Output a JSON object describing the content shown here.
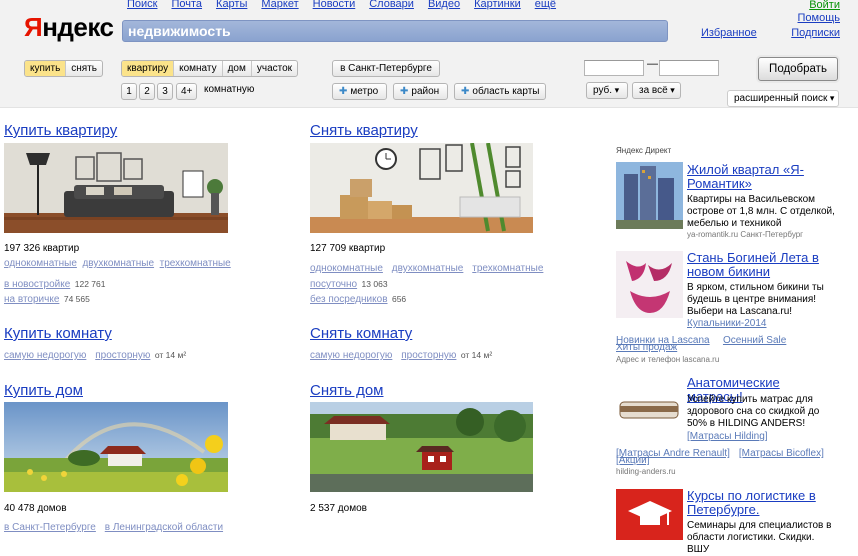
{
  "header": {
    "logo_a": "Я",
    "logo_b": "ндекс",
    "nav": [
      "Поиск",
      "Почта",
      "Карты",
      "Маркет",
      "Новости",
      "Словари",
      "Видео",
      "Картинки",
      "ещё"
    ],
    "login": "Войти",
    "help": "Помощь",
    "subscriptions": "Подписки",
    "favorites": "Избранное",
    "search_value": "недвижимость"
  },
  "filters": {
    "deal": [
      "купить",
      "снять"
    ],
    "deal_selected": "купить",
    "type": [
      "квартиру",
      "комнату",
      "дом",
      "участок"
    ],
    "type_selected": "квартиру",
    "rooms": [
      "1",
      "2",
      "3",
      "4+"
    ],
    "rooms_label": "комнатную",
    "city": "в Санкт-Петербурге",
    "metro": "метро",
    "district": "район",
    "map_area": "область карты",
    "dash": "—",
    "currency": "руб.",
    "price_period": "за всё",
    "submit": "Подобрать",
    "advanced": "расширенный поиск"
  },
  "sections": {
    "buy_flat": {
      "title": "Купить квартиру",
      "count": "197 326 квартир",
      "links": [
        "однокомнатные",
        "двухкомнатные",
        "трехкомнатные"
      ],
      "new": "в новостройке",
      "new_count": "122 761",
      "secondary": "на вторичке",
      "secondary_count": "74 565"
    },
    "rent_flat": {
      "title": "Снять квартиру",
      "count": "127 709 квартир",
      "links": [
        "однокомнатные",
        "двухкомнатные",
        "трехкомнатные"
      ],
      "daily": "посуточно",
      "daily_count": "13 063",
      "no_agent": "без посредников",
      "no_agent_count": "656"
    },
    "buy_room": {
      "title": "Купить комнату",
      "cheap": "самую недорогую",
      "spacious": "просторную",
      "from": "от 14 м²"
    },
    "rent_room": {
      "title": "Снять комнату",
      "cheap": "самую недорогую",
      "spacious": "просторную",
      "from": "от 14 м²"
    },
    "buy_house": {
      "title": "Купить дом",
      "count": "40 478 домов",
      "spb": "в Санкт-Петербурге",
      "lo": "в Ленинградской области"
    },
    "rent_house": {
      "title": "Снять дом",
      "count": "2 537 домов"
    }
  },
  "direct": {
    "header": "Яндекс Директ",
    "ads": [
      {
        "title": "Жилой квартал «Я-Романтик»",
        "text": "Квартиры на Васильевском острове от 1,8 млн. С отделкой, мебелью и техникой",
        "meta": "ya-romantik.ru   Санкт-Петербург"
      },
      {
        "title": "Стань Богиней Лета в новом бикини",
        "text": "В ярком, стильном бикини ты будешь в центре внимания! Выбери на Lascana.ru!",
        "links": [
          "Купальники-2014",
          "Новинки на Lascana",
          "Осенний Sale",
          "Хиты продаж"
        ],
        "meta": "Адрес и телефон   lascana.ru"
      },
      {
        "title": "Анатомические матрасы!",
        "text": "Успейте купить матрас для здорового сна со скидкой до 50% в HILDING ANDERS!",
        "links": [
          "[Матрасы Hilding]",
          "[Матрасы Andre Renault]",
          "[Матрасы Bicoflex]",
          "[Акции]"
        ],
        "meta": "hilding-anders.ru"
      },
      {
        "title": "Курсы по логистике в Петербурге.",
        "text": "Семинары для специалистов в области логистики. Скидки. ВШУ"
      }
    ]
  }
}
